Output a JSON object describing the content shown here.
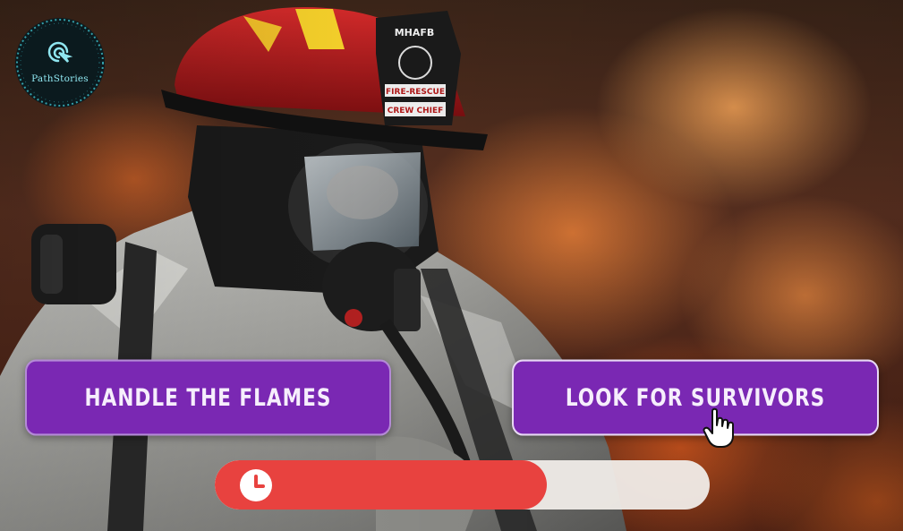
{
  "brand": {
    "logo_text": "PathStories"
  },
  "scene": {
    "image_description": "firefighter-in-gear-flames-background",
    "helmet_front_lines": [
      "MHAFB",
      "FIRE-RESCUE",
      "CREW CHIEF"
    ]
  },
  "choices": [
    {
      "label": "HANDLE THE FLAMES"
    },
    {
      "label": "LOOK FOR SURVIVORS"
    }
  ],
  "timer": {
    "remaining_fraction": 0.67,
    "icon": "clock-icon"
  },
  "colors": {
    "choice_bg": "#7a28b3",
    "timer_fill": "#e8423f",
    "timer_track": "#f0ece8",
    "logo_accent": "#8fe6f0"
  }
}
